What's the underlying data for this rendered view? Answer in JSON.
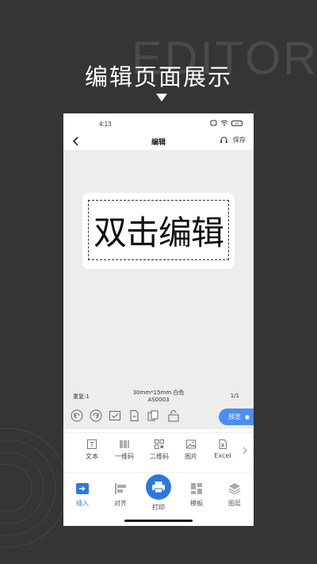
{
  "poster": {
    "background_word": "EDITOR",
    "headline": "编辑页面展示"
  },
  "status_bar": {
    "time": "4:13",
    "battery": "63"
  },
  "navbar": {
    "title": "编辑",
    "save_label": "保存"
  },
  "canvas": {
    "label_text": "双击编辑"
  },
  "label_info": {
    "repeat": "重复:1",
    "size_line": "30mm*15mm 白色",
    "model_line": "AS0003",
    "page": "1/1"
  },
  "toolbar": {
    "preview_label": "预览"
  },
  "insert_bar": {
    "items": [
      {
        "label": "文本",
        "icon": "text-icon"
      },
      {
        "label": "一维码",
        "icon": "barcode-icon"
      },
      {
        "label": "二维码",
        "icon": "qrcode-icon"
      },
      {
        "label": "图片",
        "icon": "image-icon"
      },
      {
        "label": "Excel",
        "icon": "excel-icon"
      }
    ]
  },
  "tabbar": {
    "items": [
      {
        "label": "插入",
        "icon": "insert-icon",
        "active": true
      },
      {
        "label": "对齐",
        "icon": "align-icon",
        "active": false
      },
      {
        "label": "打印",
        "icon": "printer-icon",
        "active": false
      },
      {
        "label": "模板",
        "icon": "template-icon",
        "active": false
      },
      {
        "label": "图层",
        "icon": "layers-icon",
        "active": false
      }
    ]
  },
  "colors": {
    "accent": "#2b78e4",
    "preview_button": "#4a8ff0",
    "page_background": "#353535",
    "canvas_background": "#ededed"
  }
}
